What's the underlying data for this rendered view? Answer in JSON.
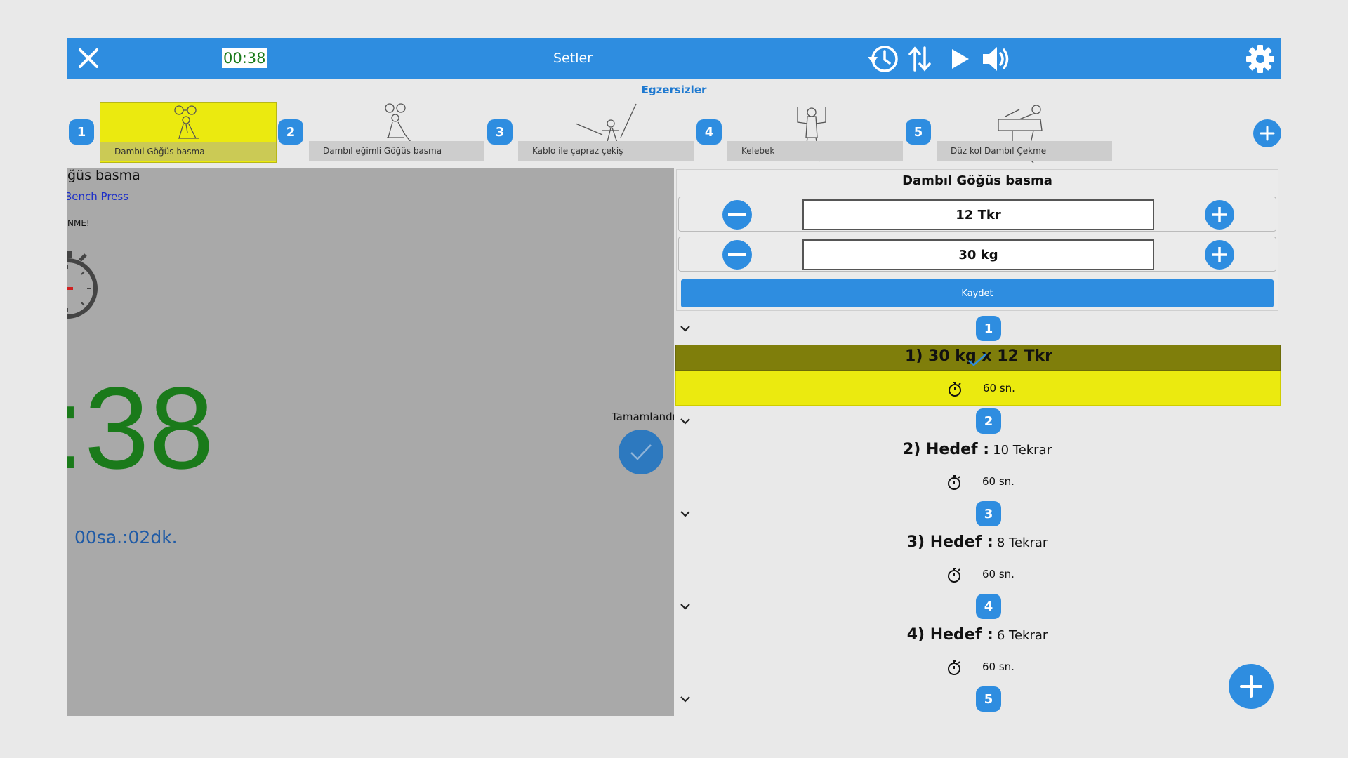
{
  "header": {
    "timer": "00:38",
    "title": "Setler",
    "icons": [
      "close-icon",
      "history-icon",
      "swap-icon",
      "play-icon",
      "volume-icon",
      "gear-icon"
    ]
  },
  "exercises": {
    "heading": "Egzersizler",
    "items": [
      {
        "number": "1",
        "label": "Dambıl Göğüs basma",
        "selected": true
      },
      {
        "number": "2",
        "label": "Dambıl eğimli Göğüs basma",
        "selected": false
      },
      {
        "number": "3",
        "label": "Kablo ile çapraz çekiş",
        "selected": false
      },
      {
        "number": "4",
        "label": "Kelebek",
        "selected": false
      },
      {
        "number": "5",
        "label": "Düz kol Dambıl Çekme",
        "selected": false
      }
    ]
  },
  "left_panel": {
    "exercise_name": "ğüs basma",
    "exercise_alt": "Bench Press",
    "rest_label": "NME!",
    "big_timer": ":38",
    "elapsed": "00sa.:02dk.",
    "complete_label": "Tamamlandı"
  },
  "editor": {
    "title": "Dambıl Göğüs basma",
    "reps": "12 Tkr",
    "weight": "30 kg",
    "save_label": "Kaydet"
  },
  "sets": [
    {
      "number": "1",
      "title": "1) 30 kg x 12 Tkr",
      "target": "",
      "rest": "60 sn.",
      "done": true
    },
    {
      "number": "2",
      "title": "2) Hedef :",
      "target": "10 Tekrar",
      "rest": "60 sn.",
      "done": false
    },
    {
      "number": "3",
      "title": "3) Hedef :",
      "target": "8 Tekrar",
      "rest": "60 sn.",
      "done": false
    },
    {
      "number": "4",
      "title": "4) Hedef :",
      "target": "6 Tekrar",
      "rest": "60 sn.",
      "done": false
    },
    {
      "number": "5",
      "title": "",
      "target": "",
      "rest": "",
      "done": false
    }
  ],
  "colors": {
    "accent": "#2e8de0",
    "selected_yellow": "#ebea0f",
    "done_header": "#7f7e0b",
    "timer_green": "#1a7a1a",
    "left_panel_bg": "#a9a9a9"
  }
}
